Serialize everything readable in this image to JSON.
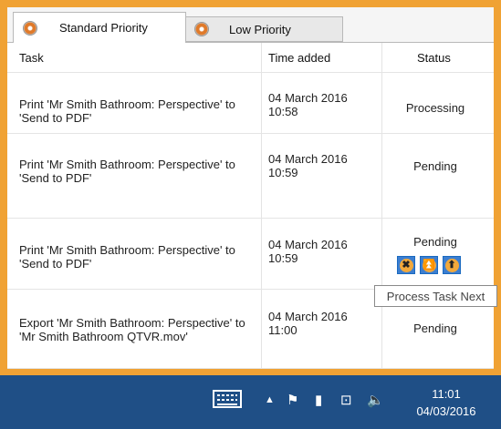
{
  "tabs": [
    {
      "label": "Standard Priority",
      "active": true
    },
    {
      "label": "Low Priority",
      "active": false
    }
  ],
  "table": {
    "headers": {
      "task": "Task",
      "time": "Time added",
      "status": "Status"
    },
    "rows": [
      {
        "task": "Print 'Mr Smith Bathroom: Perspective' to 'Send to PDF'",
        "time": "04 March 2016 10:58",
        "status": "Processing"
      },
      {
        "task": "Print 'Mr Smith Bathroom: Perspective' to 'Send to PDF'",
        "time": "04 March 2016 10:59",
        "status": "Pending"
      },
      {
        "task": "Print 'Mr Smith Bathroom: Perspective' to 'Send to PDF'",
        "time": "04 March 2016 10:59",
        "status": "Pending"
      },
      {
        "task": "Export 'Mr Smith Bathroom: Perspective' to 'Mr Smith Bathroom QTVR.mov'",
        "time": "04 March 2016 11:00",
        "status": "Pending"
      }
    ]
  },
  "row_actions": [
    {
      "name": "cancel-task-icon",
      "glyph": "✖"
    },
    {
      "name": "process-next-icon",
      "glyph": "⏫"
    },
    {
      "name": "move-up-icon",
      "glyph": "⬆"
    }
  ],
  "tooltip": "Process Task Next",
  "taskbar": {
    "time": "11:01",
    "date": "04/03/2016",
    "tray_icons": [
      "keyboard-icon",
      "chevron-up-icon",
      "flag-icon",
      "battery-icon",
      "network-icon",
      "volume-icon"
    ]
  },
  "colors": {
    "frame": "#f0a234",
    "taskbar": "#1f4f86"
  }
}
